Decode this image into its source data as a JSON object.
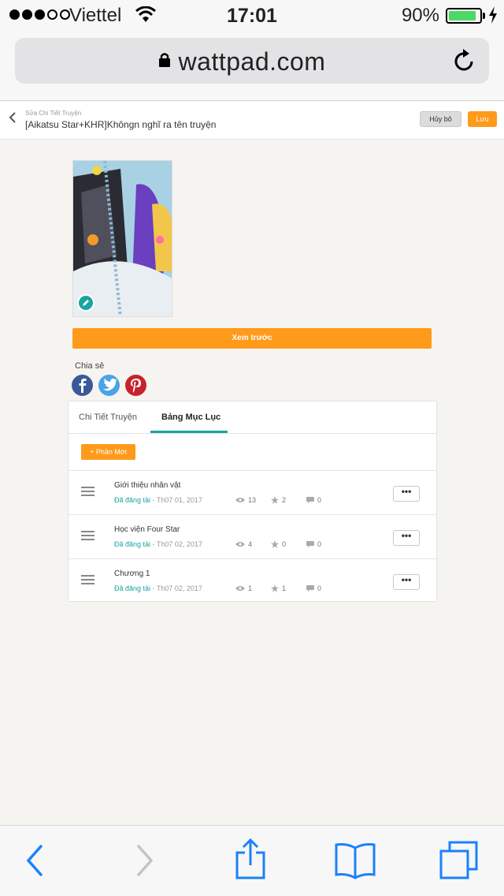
{
  "status_bar": {
    "carrier": "Viettel",
    "time": "17:01",
    "battery": "90%",
    "battery_level": 0.9
  },
  "browser": {
    "url": "wattpad.com"
  },
  "header": {
    "breadcrumb": "Sửa Chi Tiết Truyện",
    "title": "[Aikatsu Star+KHR]Khôngn nghĩ ra tên truyện",
    "cancel_label": "Hủy bỏ",
    "save_label": "Lưu"
  },
  "cover": {
    "preview_label": "Xem trước"
  },
  "share": {
    "label": "Chia sẻ"
  },
  "tabs": [
    {
      "label": "Chi Tiết Truyện",
      "active": false
    },
    {
      "label": "Bảng Mục Lục",
      "active": true
    }
  ],
  "toc": {
    "new_part_label": "+ Phần Mới",
    "parts": [
      {
        "title": "Giới thiệu nhân vật",
        "status": "Đã đăng tải",
        "date": " - Th07 01, 2017",
        "views": "13",
        "votes": "2",
        "comments": "0"
      },
      {
        "title": "Học viện Four Star",
        "status": "Đã đăng tải",
        "date": " - Th07 02, 2017",
        "views": "4",
        "votes": "0",
        "comments": "0"
      },
      {
        "title": "Chương 1",
        "status": "Đã đăng tải",
        "date": " - Th07 02, 2017",
        "views": "1",
        "votes": "1",
        "comments": "0"
      }
    ],
    "more_label": "•••"
  },
  "colors": {
    "accent": "#ff9a1b",
    "teal": "#19a5a0",
    "ios_blue": "#1a82fb"
  }
}
